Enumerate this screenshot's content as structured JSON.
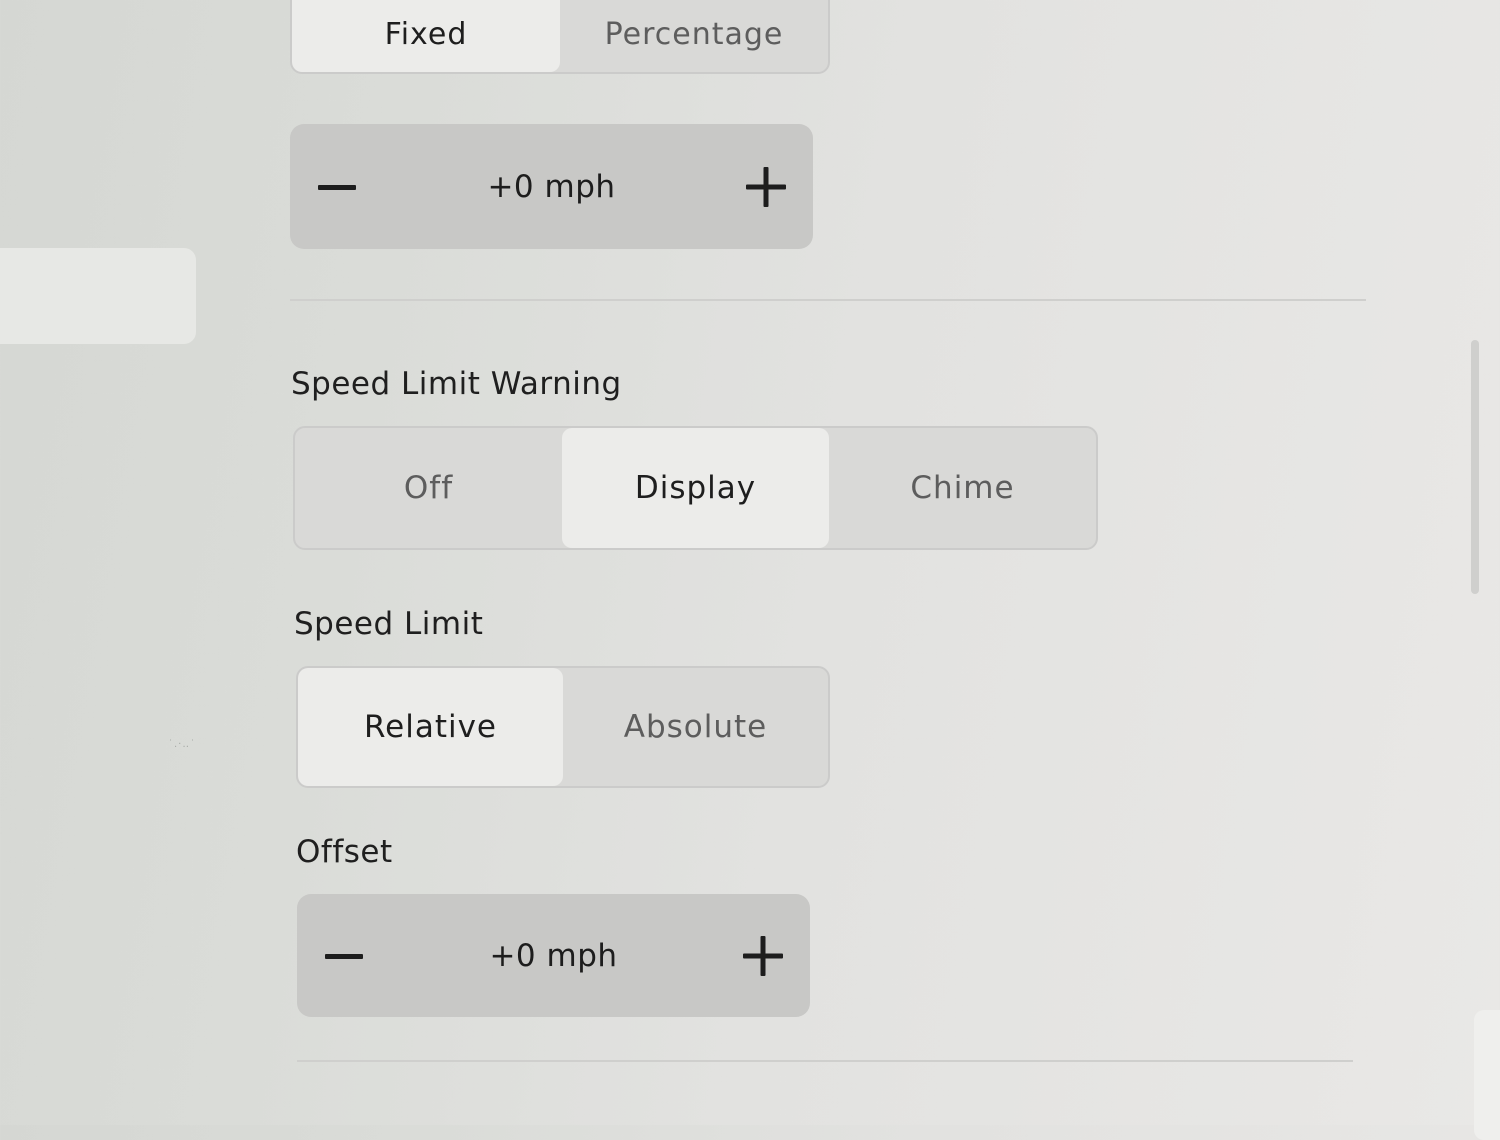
{
  "top_mode": {
    "options": [
      "Fixed",
      "Percentage"
    ],
    "selected": "Fixed"
  },
  "top_offset": {
    "value": "+0 mph"
  },
  "speed_limit_warning": {
    "label": "Speed Limit Warning",
    "options": [
      "Off",
      "Display",
      "Chime"
    ],
    "selected": "Display"
  },
  "speed_limit": {
    "label": "Speed Limit",
    "options": [
      "Relative",
      "Absolute"
    ],
    "selected": "Relative"
  },
  "offset": {
    "label": "Offset",
    "value": "+0 mph"
  },
  "icons": {
    "decrement": "minus-icon",
    "increment": "plus-icon"
  },
  "colors": {
    "page_background": "#dedfdc",
    "segment_track": "#d9d9d7",
    "segment_active": "#ececea",
    "stepper_background": "#c8c8c6",
    "text_primary": "#1f1f1f",
    "text_secondary": "#5d5d5d"
  }
}
